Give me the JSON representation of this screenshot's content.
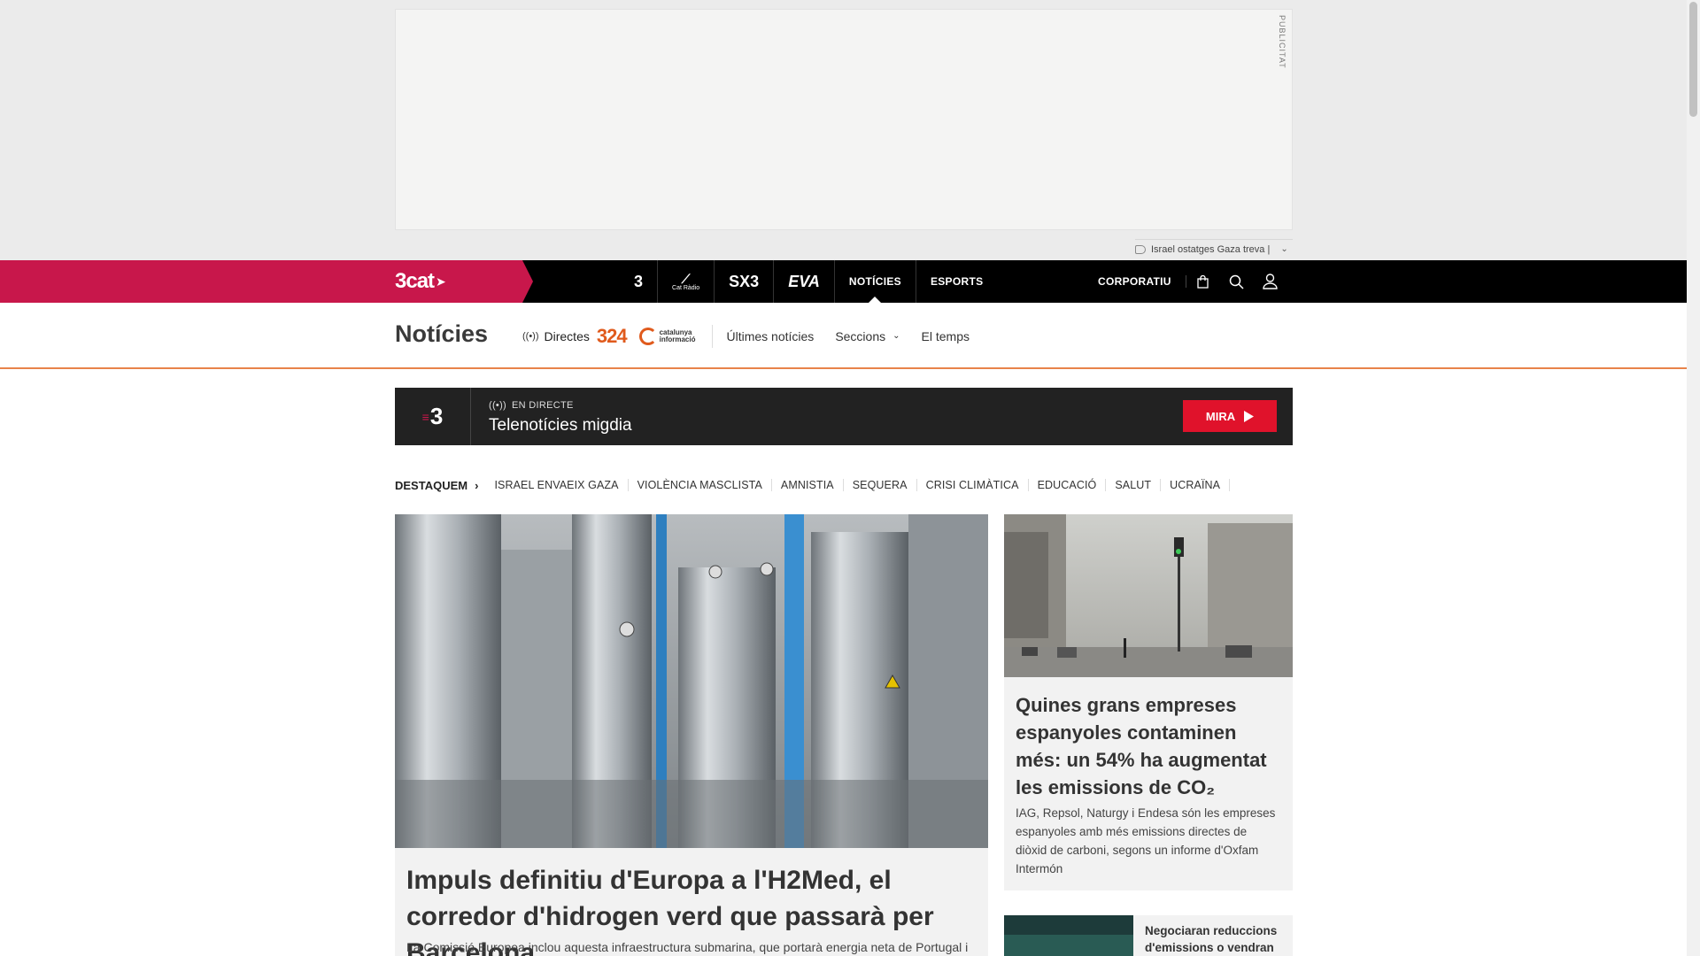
{
  "ad": {
    "label": "PUBLICITAT"
  },
  "topic_select": {
    "value": "Israel ostatges Gaza treva |"
  },
  "brand": {
    "name": "3cat"
  },
  "channels": [
    {
      "label": "3"
    },
    {
      "label": "Cat Ràdio"
    },
    {
      "label": "SX3"
    },
    {
      "label": "EVA"
    },
    {
      "label": "NOTÍCIES"
    },
    {
      "label": "ESPORTS"
    }
  ],
  "nav_right": {
    "corporate": "CORPORATIU"
  },
  "subnav": {
    "title": "Notícies",
    "directes": "Directes",
    "logo_324": "324",
    "logo_ci_line1": "catalunya",
    "logo_ci_line2": "informació",
    "links": {
      "latest": "Últimes notícies",
      "sections": "Seccions",
      "weather": "El temps"
    }
  },
  "live": {
    "channel": "3",
    "tag": "EN DIRECTE",
    "title": "Telenotícies migdia",
    "button": "MIRA"
  },
  "destaquem": {
    "title": "DESTAQUEM",
    "items": [
      "ISRAEL ENVAEIX GAZA",
      "VIOLÈNCIA MASCLISTA",
      "AMNISTIA",
      "SEQUERA",
      "CRISI CLIMÀTICA",
      "EDUCACIÓ",
      "SALUT",
      "UCRAÏNA"
    ]
  },
  "main_story": {
    "headline": "Impuls definitiu d'Europa a l'H2Med, el corredor d'hidrogen verd que passarà per Barcelona",
    "lead": "La Comissió Europea inclou aquesta infraestructura submarina, que portarà energia neta de Portugal i"
  },
  "side_story": {
    "headline": "Quines grans empreses espanyoles contaminen més: un 54% ha augmentat les emissions de CO₂",
    "lead": "IAG, Repsol, Naturgy i Endesa són les empreses espanyoles amb més emissions directes de diòxid de carboni, segons un informe d'Oxfam Intermón"
  },
  "small_story": {
    "headline": "Negociaran reduccions d'emissions o vendran"
  },
  "colors": {
    "brand": "#c8174b",
    "accent_line": "#e8834a",
    "live_button": "#e0122b"
  }
}
